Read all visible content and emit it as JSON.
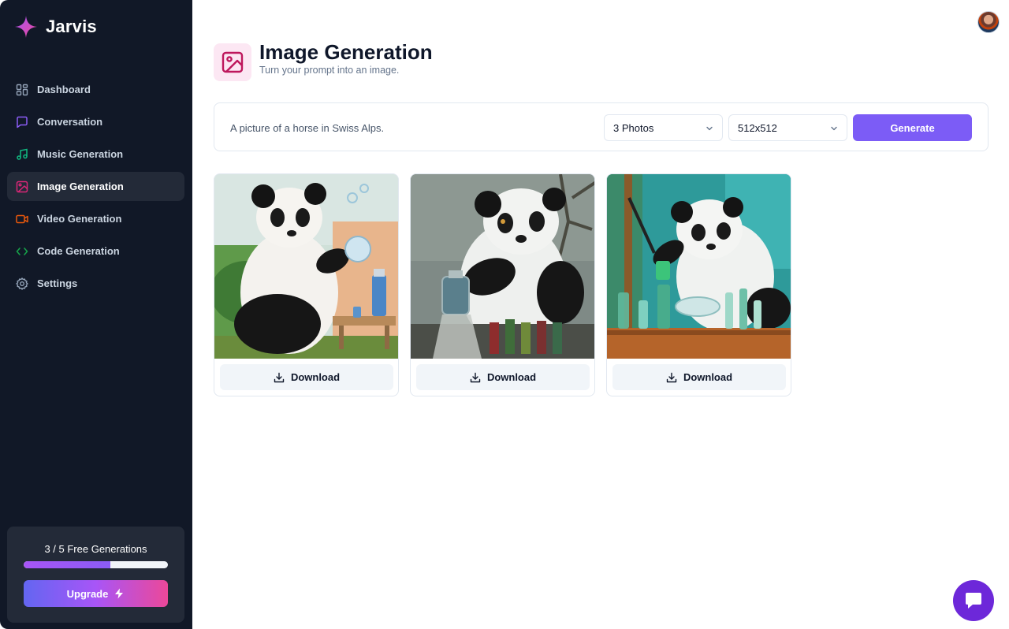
{
  "app": {
    "name": "Jarvis"
  },
  "sidebar": {
    "items": [
      {
        "label": "Dashboard",
        "icon": "dashboard-icon",
        "color": "#94a3b8",
        "active": false
      },
      {
        "label": "Conversation",
        "icon": "message-square-icon",
        "color": "#8b5cf6",
        "active": false
      },
      {
        "label": "Music Generation",
        "icon": "music-icon",
        "color": "#10b981",
        "active": false
      },
      {
        "label": "Image Generation",
        "icon": "image-icon",
        "color": "#db2777",
        "active": true
      },
      {
        "label": "Video Generation",
        "icon": "video-icon",
        "color": "#ea580c",
        "active": false
      },
      {
        "label": "Code Generation",
        "icon": "code-icon",
        "color": "#16a34a",
        "active": false
      },
      {
        "label": "Settings",
        "icon": "gear-icon",
        "color": "#94a3b8",
        "active": false
      }
    ],
    "usage": {
      "text": "3 / 5 Free Generations",
      "used": 3,
      "limit": 5,
      "progress": 0.6
    },
    "upgrade_label": "Upgrade"
  },
  "header": {
    "title": "Image Generation",
    "subtitle": "Turn your prompt into an image.",
    "icon": "image-icon",
    "icon_color": "#be185d",
    "icon_bg": "#fce7f3"
  },
  "form": {
    "prompt_value": "A picture of a horse in Swiss Alps.",
    "amount": "3 Photos",
    "resolution": "512x512",
    "generate_label": "Generate"
  },
  "results": [
    {
      "download_label": "Download"
    },
    {
      "download_label": "Download"
    },
    {
      "download_label": "Download"
    }
  ],
  "colors": {
    "sidebar_bg": "#111827",
    "accent": "#7c5cf6",
    "active_item_bg": "#232a38",
    "chat_button": "#6d28d9"
  }
}
